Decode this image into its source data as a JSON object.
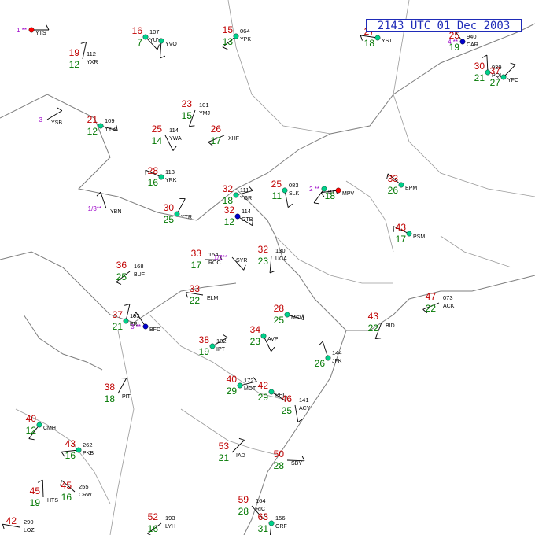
{
  "header": {
    "title": "2143 UTC 01 Dec 2003"
  },
  "colors": {
    "temp": "#c00000",
    "dewpoint": "#007700",
    "id": "#000000",
    "pressure": "#000000",
    "weather": "#9b00c8",
    "station_ok": "#00d08a",
    "station_flag": "#ff0000",
    "station_obscured": "#0000cc",
    "coast": "#7d7d7d",
    "title_box": "#1f2bb8"
  },
  "stations": [
    {
      "id": "YTS",
      "t": "",
      "td": "",
      "p": "",
      "wx": "1 **",
      "dot": "red"
    },
    {
      "id": "YUY",
      "t": "16",
      "td": "7",
      "p": "107",
      "wx": "",
      "dot": "green"
    },
    {
      "id": "YVO",
      "t": "",
      "td": "",
      "p": "",
      "wx": "",
      "dot": "green"
    },
    {
      "id": "YPK",
      "t": "15",
      "td": "13",
      "p": "064",
      "wx": "",
      "dot": "green"
    },
    {
      "id": "YST",
      "t": "27",
      "td": "18",
      "p": "",
      "wx": "",
      "dot": "green"
    },
    {
      "id": "CAR",
      "t": "25",
      "td": "19",
      "p": "940",
      "wx": "4 **",
      "dot": "blue"
    },
    {
      "id": "YXR",
      "t": "19",
      "td": "12",
      "p": "112",
      "wx": "",
      "dot": "none"
    },
    {
      "id": "YSB",
      "t": "",
      "td": "",
      "p": "",
      "wx": "3",
      "dot": "none"
    },
    {
      "id": "YYB",
      "t": "21",
      "td": "12",
      "p": "109",
      "wx": "",
      "dot": "green"
    },
    {
      "id": "YWA",
      "t": "25",
      "td": "14",
      "p": "114",
      "wx": "",
      "dot": "none"
    },
    {
      "id": "YMJ",
      "t": "23",
      "td": "15",
      "p": "101",
      "wx": "",
      "dot": "none"
    },
    {
      "id": "XHF",
      "t": "26",
      "td": "17",
      "p": "",
      "wx": "",
      "dot": "none"
    },
    {
      "id": "YRK",
      "t": "28",
      "td": "16",
      "p": "113",
      "wx": "",
      "dot": "green"
    },
    {
      "id": "YBN",
      "t": "",
      "td": "",
      "p": "",
      "wx": "1/3**",
      "dot": "none"
    },
    {
      "id": "YTR",
      "t": "30",
      "td": "25",
      "p": "",
      "wx": "",
      "dot": "green"
    },
    {
      "id": "YGR",
      "t": "32",
      "td": "18",
      "p": "111",
      "wx": "",
      "dot": "green"
    },
    {
      "id": "GTB",
      "t": "32",
      "td": "12",
      "p": "114",
      "wx": "",
      "dot": "blue"
    },
    {
      "id": "SLK",
      "t": "25",
      "td": "11",
      "p": "083",
      "wx": "",
      "dot": "green"
    },
    {
      "id": "BTV",
      "t": "",
      "td": "",
      "p": "",
      "wx": "2 **",
      "dot": "green"
    },
    {
      "id": "MPV",
      "t": "",
      "td": "18",
      "p": "",
      "wx": "",
      "dot": "red"
    },
    {
      "id": "EPM",
      "t": "33",
      "td": "26",
      "p": "",
      "wx": "",
      "dot": "green"
    },
    {
      "id": "PQI",
      "t": "30",
      "td": "21",
      "p": "939",
      "wx": "",
      "dot": "green"
    },
    {
      "id": "YFC",
      "t": "37",
      "td": "27",
      "p": "",
      "wx": "",
      "dot": "green"
    },
    {
      "id": "ROC",
      "t": "33",
      "td": "17",
      "p": "154",
      "wx": "",
      "dot": "none"
    },
    {
      "id": "SYR",
      "t": "",
      "td": "",
      "p": "",
      "wx": "1/2**",
      "dot": "none"
    },
    {
      "id": "UCA",
      "t": "32",
      "td": "23",
      "p": "130",
      "wx": "",
      "dot": "none"
    },
    {
      "id": "BUF",
      "t": "36",
      "td": "25",
      "p": "168",
      "wx": "",
      "dot": "none"
    },
    {
      "id": "ELM",
      "t": "33",
      "td": "22",
      "p": "",
      "wx": "",
      "dot": "none"
    },
    {
      "id": "BFD",
      "t": "",
      "td": "",
      "p": "",
      "wx": "3 **",
      "dot": "blue"
    },
    {
      "id": "ERI",
      "t": "37",
      "td": "21",
      "p": "193",
      "wx": "",
      "dot": "green"
    },
    {
      "id": "IPT",
      "t": "38",
      "td": "19",
      "p": "182",
      "wx": "",
      "dot": "green"
    },
    {
      "id": "MSV",
      "t": "28",
      "td": "25",
      "p": "",
      "wx": "",
      "dot": "green"
    },
    {
      "id": "AVP",
      "t": "34",
      "td": "23",
      "p": "",
      "wx": "",
      "dot": "green"
    },
    {
      "id": "BID",
      "t": "43",
      "td": "22",
      "p": "",
      "wx": "",
      "dot": "none"
    },
    {
      "id": "ACK",
      "t": "47",
      "td": "22",
      "p": "073",
      "wx": "",
      "dot": "none"
    },
    {
      "id": "PSM",
      "t": "43",
      "td": "17",
      "p": "",
      "wx": "",
      "dot": "green"
    },
    {
      "id": "JFK",
      "t": "",
      "td": "26",
      "p": "144",
      "wx": "",
      "dot": "green"
    },
    {
      "id": "PIT",
      "t": "38",
      "td": "18",
      "p": "",
      "wx": "",
      "dot": "none"
    },
    {
      "id": "MDT",
      "t": "40",
      "td": "29",
      "p": "172",
      "wx": "",
      "dot": "green"
    },
    {
      "id": "PHL",
      "t": "42",
      "td": "29",
      "p": "",
      "wx": "",
      "dot": "green"
    },
    {
      "id": "ACY",
      "t": "46",
      "td": "25",
      "p": "141",
      "wx": "",
      "dot": "none"
    },
    {
      "id": "CMH",
      "t": "40",
      "td": "12",
      "p": "",
      "wx": "",
      "dot": "green"
    },
    {
      "id": "PKB",
      "t": "43",
      "td": "16",
      "p": "262",
      "wx": "",
      "dot": "green"
    },
    {
      "id": "CRW",
      "t": "45",
      "td": "16",
      "p": "255",
      "wx": "",
      "dot": "none"
    },
    {
      "id": "HTS",
      "t": "45",
      "td": "19",
      "p": "",
      "wx": "",
      "dot": "none"
    },
    {
      "id": "IAD",
      "t": "53",
      "td": "21",
      "p": "",
      "wx": "",
      "dot": "none"
    },
    {
      "id": "SBY",
      "t": "50",
      "td": "28",
      "p": "",
      "wx": "",
      "dot": "none"
    },
    {
      "id": "RIC",
      "t": "59",
      "td": "28",
      "p": "164",
      "wx": "",
      "dot": "none"
    },
    {
      "id": "ORF",
      "t": "63",
      "td": "31",
      "p": "156",
      "wx": "",
      "dot": "green"
    },
    {
      "id": "LYH",
      "t": "52",
      "td": "16",
      "p": "193",
      "wx": "",
      "dot": "none"
    },
    {
      "id": "LOZ",
      "t": "42",
      "td": "",
      "p": "290",
      "wx": "",
      "dot": "none"
    }
  ]
}
